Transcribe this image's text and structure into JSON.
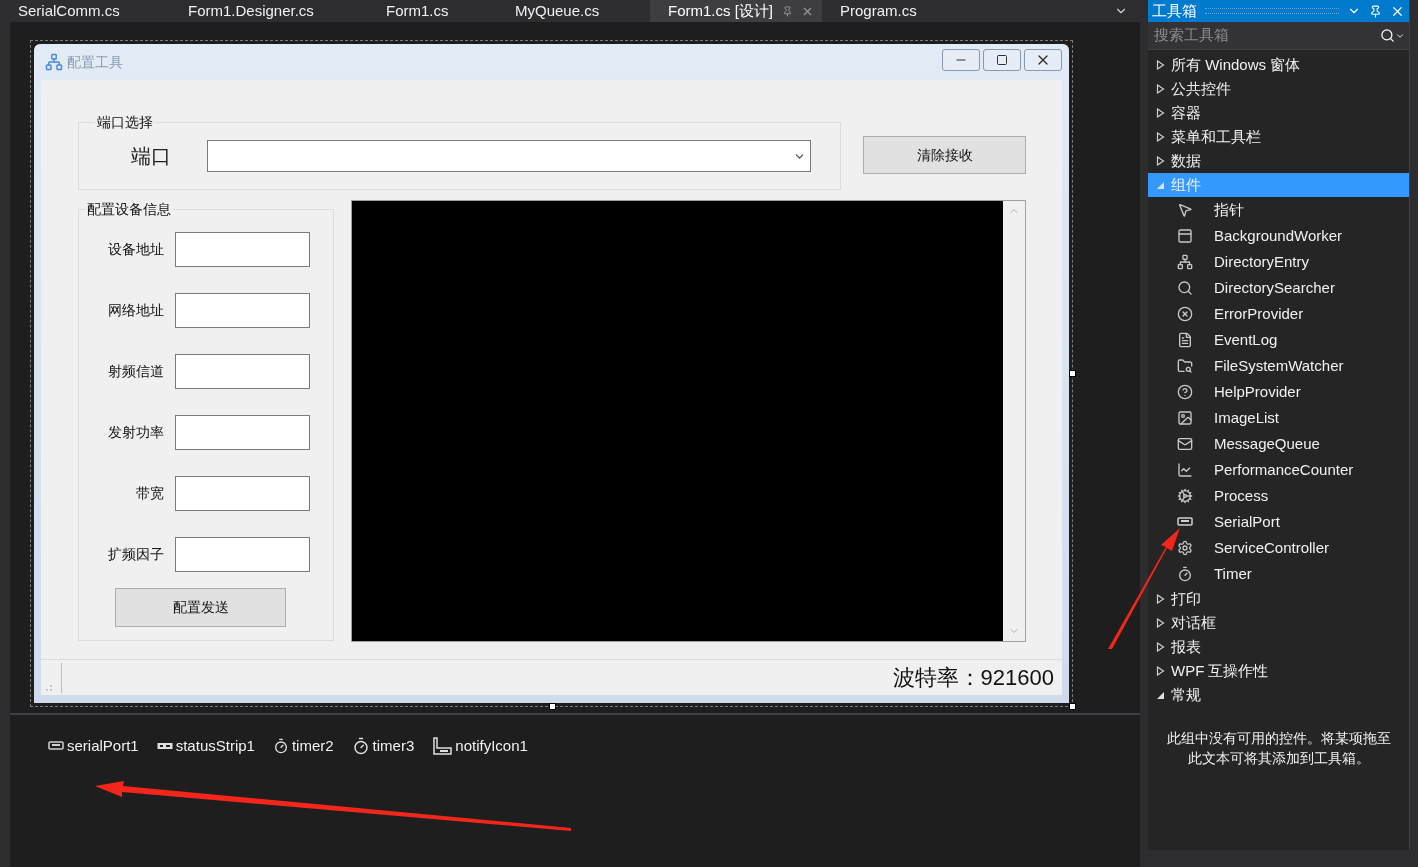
{
  "tabs": [
    {
      "label": "SerialComm.cs",
      "selected": false
    },
    {
      "label": "Form1.Designer.cs",
      "selected": false
    },
    {
      "label": "Form1.cs",
      "selected": false
    },
    {
      "label": "MyQueue.cs",
      "selected": false
    },
    {
      "label": "Form1.cs [设计]",
      "selected": true
    },
    {
      "label": "Program.cs",
      "selected": false
    }
  ],
  "form": {
    "title": "配置工具",
    "port_group": {
      "title": "端口选择",
      "label": "端口",
      "button": "清除接收"
    },
    "device_group": {
      "title": "配置设备信息",
      "fields": [
        {
          "label": "设备地址"
        },
        {
          "label": "网络地址"
        },
        {
          "label": "射频信道"
        },
        {
          "label": "发射功率"
        },
        {
          "label": "带宽"
        },
        {
          "label": "扩频因子"
        }
      ],
      "button": "配置发送"
    },
    "status_text": "波特率：921600"
  },
  "component_tray": [
    {
      "label": "serialPort1"
    },
    {
      "label": "statusStrip1"
    },
    {
      "label": "timer2"
    },
    {
      "label": "timer3"
    },
    {
      "label": "notifyIcon1"
    }
  ],
  "toolbox": {
    "title": "工具箱",
    "search": {
      "placeholder": "搜索工具箱"
    },
    "items": [
      {
        "label": "所有 Windows 窗体",
        "expanded": false,
        "selected": false
      },
      {
        "label": "公共控件",
        "expanded": false,
        "selected": false
      },
      {
        "label": "容器",
        "expanded": false,
        "selected": false
      },
      {
        "label": "菜单和工具栏",
        "expanded": false,
        "selected": false
      },
      {
        "label": "数据",
        "expanded": false,
        "selected": false
      },
      {
        "label": "组件",
        "expanded": true,
        "selected": true,
        "children": [
          {
            "label": "指针"
          },
          {
            "label": "BackgroundWorker"
          },
          {
            "label": "DirectoryEntry"
          },
          {
            "label": "DirectorySearcher"
          },
          {
            "label": "ErrorProvider"
          },
          {
            "label": "EventLog"
          },
          {
            "label": "FileSystemWatcher"
          },
          {
            "label": "HelpProvider"
          },
          {
            "label": "ImageList"
          },
          {
            "label": "MessageQueue"
          },
          {
            "label": "PerformanceCounter"
          },
          {
            "label": "Process"
          },
          {
            "label": "SerialPort"
          },
          {
            "label": "ServiceController"
          },
          {
            "label": "Timer"
          }
        ]
      },
      {
        "label": "打印",
        "expanded": false,
        "selected": false
      },
      {
        "label": "对话框",
        "expanded": false,
        "selected": false
      },
      {
        "label": "报表",
        "expanded": false,
        "selected": false
      },
      {
        "label": "WPF 互操作性",
        "expanded": false,
        "selected": false
      },
      {
        "label": "常规",
        "expanded": true,
        "selected": false,
        "empty_message": "此组中没有可用的控件。将某项拖至此文本可将其添加到工具箱。"
      }
    ]
  }
}
